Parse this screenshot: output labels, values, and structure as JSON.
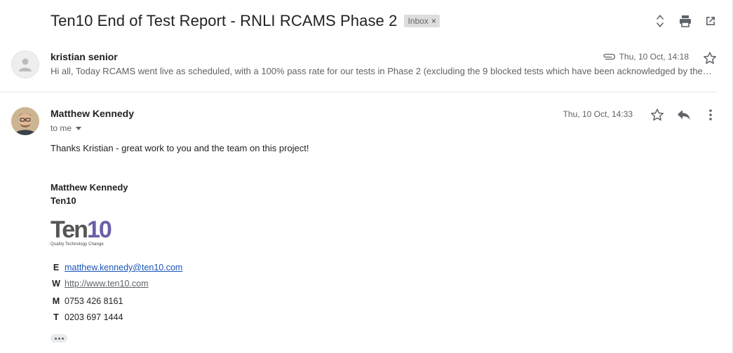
{
  "thread": {
    "subject": "Ten10 End of Test Report - RNLI RCAMS Phase 2",
    "label": "Inbox",
    "label_close": "×"
  },
  "messages": [
    {
      "sender": "kristian senior",
      "date": "Thu, 10 Oct, 14:18",
      "snippet": "Hi all, Today RCAMS went live as scheduled, with a 100% pass rate for our tests in Phase 2 (excluding the 9 blocked tests which have been acknowledged by the business). Full report attached."
    },
    {
      "sender": "Matthew Kennedy",
      "recipient": "to me",
      "date": "Thu, 10 Oct, 14:33",
      "body": "Thanks Kristian - great work to you and the team on this project!",
      "signature": {
        "name": "Matthew Kennedy",
        "company": "Ten10",
        "logo_text_a": "Ten",
        "logo_text_b": "10",
        "logo_tagline": "Quality Technology Change",
        "contacts": [
          {
            "key": "E",
            "value": "matthew.kennedy@ten10.com"
          },
          {
            "key": "W",
            "value": "http://www.ten10.com"
          },
          {
            "key": "M",
            "value": "0753 426 8161"
          },
          {
            "key": "T",
            "value": "0203 697 1444"
          }
        ]
      }
    }
  ],
  "colors": {
    "logo_purple": "#6a5fa8",
    "logo_gray": "#555555",
    "link": "#1a55b8"
  }
}
